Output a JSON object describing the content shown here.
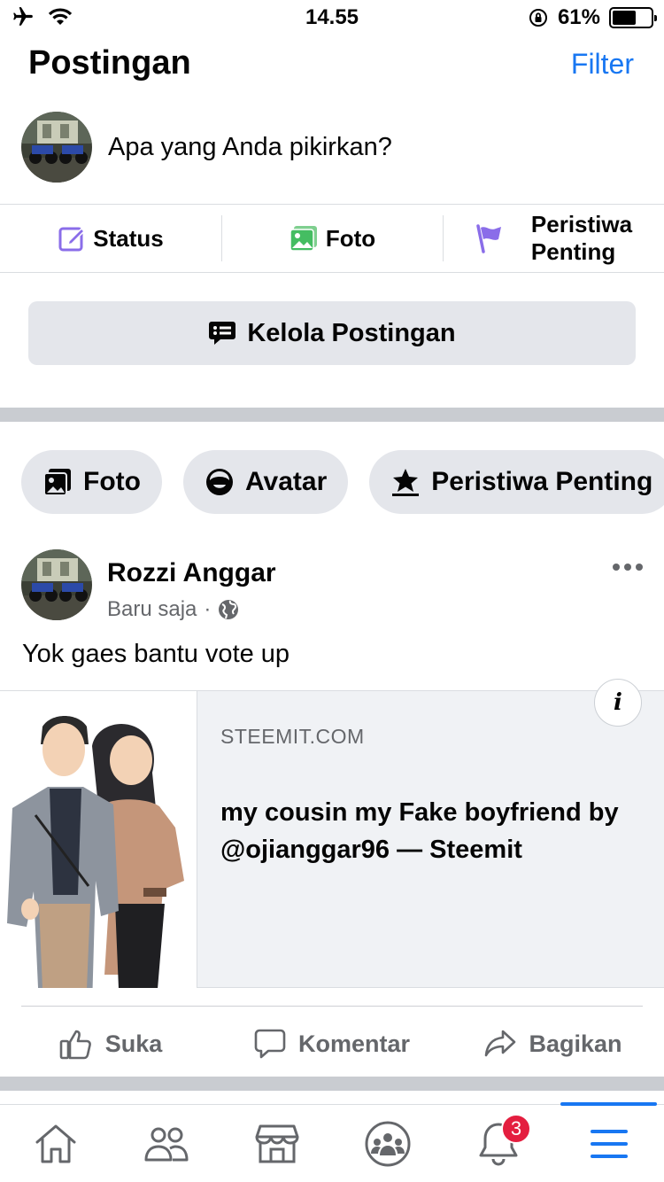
{
  "status_bar": {
    "time": "14.55",
    "battery_percent": "61%",
    "battery_level": 0.61
  },
  "header": {
    "title": "Postingan",
    "filter_label": "Filter"
  },
  "composer": {
    "placeholder": "Apa yang Anda pikirkan?"
  },
  "quick_actions": [
    {
      "label": "Status",
      "icon": "edit-icon"
    },
    {
      "label": "Foto",
      "icon": "photo-icon"
    },
    {
      "label_line1": "Peristiwa",
      "label_line2": "Penting",
      "icon": "flag-icon"
    }
  ],
  "manage_posts": {
    "label": "Kelola Postingan",
    "icon": "speech-list-icon"
  },
  "chips": [
    {
      "label": "Foto",
      "icon": "photo-album-icon"
    },
    {
      "label": "Avatar",
      "icon": "avatar-face-icon"
    },
    {
      "label": "Peristiwa Penting",
      "icon": "star-flag-icon"
    }
  ],
  "post": {
    "author": "Rozzi Anggar",
    "time": "Baru saja",
    "separator": "·",
    "privacy_icon": "globe-icon",
    "text": "Yok gaes bantu vote up",
    "link": {
      "domain": "STEEMIT.COM",
      "title": "my cousin my Fake boyfriend by @ojianggar96 — Steemit",
      "info": "i"
    }
  },
  "reactions": [
    {
      "label": "Suka",
      "icon": "like-icon"
    },
    {
      "label": "Komentar",
      "icon": "comment-icon"
    },
    {
      "label": "Bagikan",
      "icon": "share-icon"
    }
  ],
  "tab_bar": {
    "tabs": [
      "home-icon",
      "friends-icon",
      "marketplace-icon",
      "groups-icon",
      "notifications-icon",
      "menu-icon"
    ],
    "active": "menu-icon",
    "notification_count": "3"
  },
  "colors": {
    "accent": "#1877f2",
    "badge": "#e41e3f",
    "separator": "#c9ccd1",
    "button_bg": "#e4e6eb"
  }
}
